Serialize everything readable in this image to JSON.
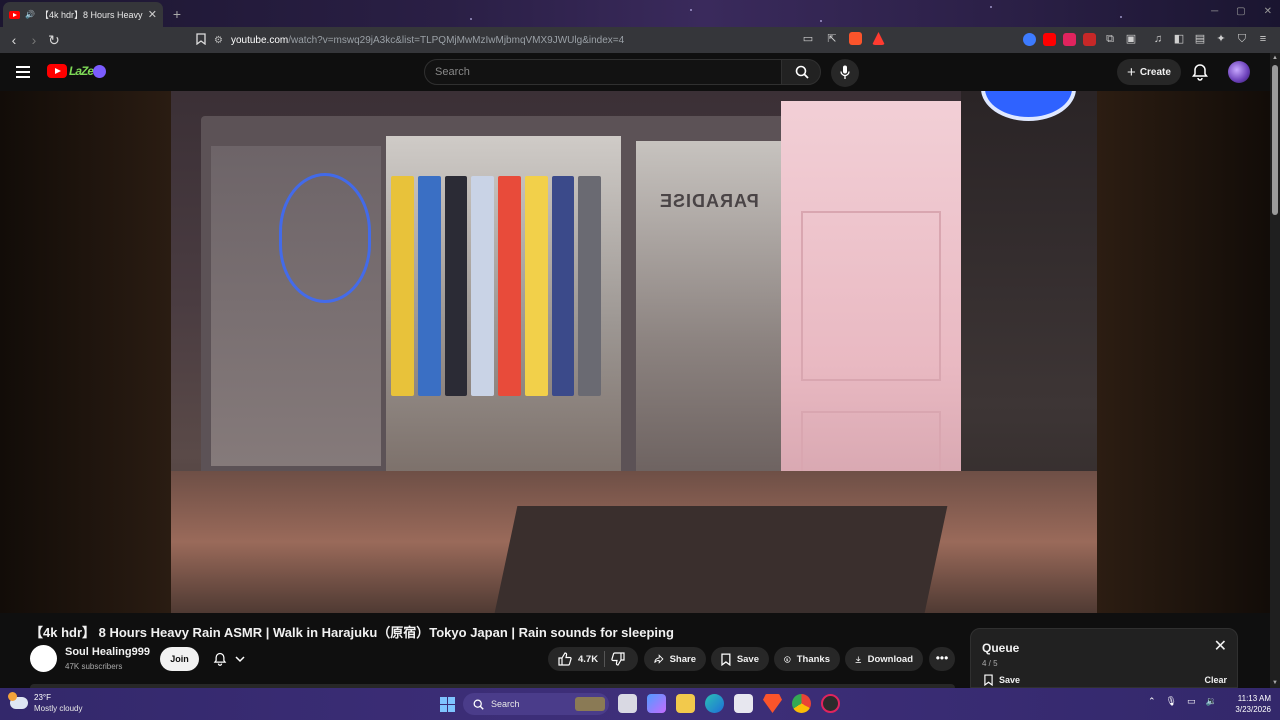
{
  "browser": {
    "tab_title": "【4k hdr】8 Hours Heavy Rain",
    "tab_close": "✕",
    "new_tab": "+",
    "url_host": "youtube.com",
    "url_rest": "/watch?v=mswq29jA3kc&list=TLPQMjMwMzIwMjbmqVMX9JWUlg&index=4"
  },
  "youtube_header": {
    "search_placeholder": "Search",
    "create_label": "Create"
  },
  "video": {
    "title": "【4k hdr】 8 Hours Heavy Rain ASMR | Walk in Harajuku（原宿）Tokyo Japan | Rain sounds for sleeping",
    "scene_sign": "PARADISE"
  },
  "channel": {
    "name": "Soul Healing999",
    "subscribers": "47K subscribers",
    "join_label": "Join"
  },
  "actions": {
    "likes": "4.7K",
    "share": "Share",
    "save": "Save",
    "thanks": "Thanks",
    "download": "Download",
    "more": "•••"
  },
  "queue": {
    "title": "Queue",
    "position": "4 / 5",
    "save": "Save",
    "clear": "Clear",
    "close": "✕"
  },
  "taskbar": {
    "temperature": "23°F",
    "condition": "Mostly cloudy",
    "search_label": "Search",
    "time": "11:13 AM",
    "date": "3/23/2026"
  },
  "colors": {
    "youtube_red": "#ff0000",
    "page_bg": "#0f0f0f",
    "pill_bg": "#272727",
    "taskbar": "#3e2f7a"
  }
}
